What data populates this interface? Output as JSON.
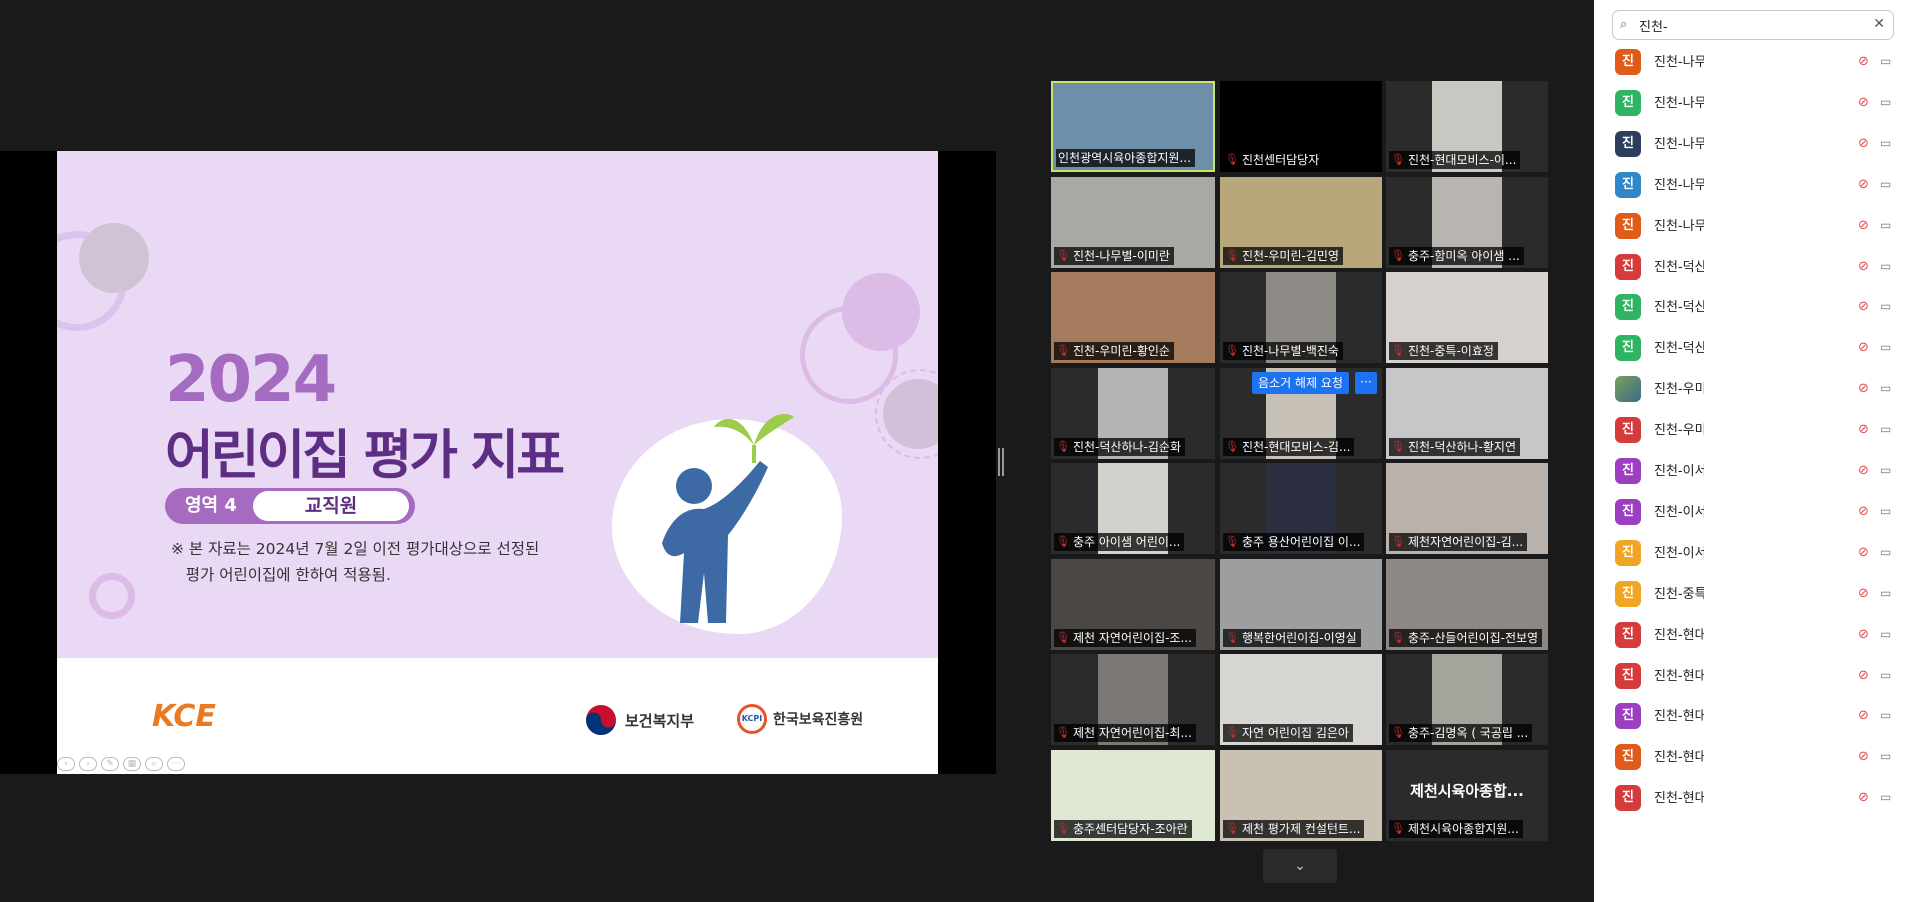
{
  "slide": {
    "year": "2024",
    "title": "어린이집 평가 지표",
    "area_label": "영역 4",
    "area_name": "교직원",
    "note": "※ 본 자료는 2024년 7월 2일 이전 평가대상으로 선정된\n   평가 어린이집에 한하여 적용됨.",
    "logo_kce": "KCE",
    "org1": "보건복지부",
    "org2": "한국보육진흥원",
    "org2_mark": "KCPI"
  },
  "gallery": {
    "unmute_request": "음소거 해제 요청",
    "more": "···",
    "tiles": [
      {
        "name": "인천광역시육아종합지원...",
        "bg": "#6f8ea8",
        "muted": false,
        "active": true
      },
      {
        "name": "진천센터담당자",
        "bg": "#000000",
        "muted": true
      },
      {
        "name": "진천-현대모비스-이...",
        "bg": "#c9c7c2",
        "muted": true
      },
      {
        "name": "진천-나무별-이미란",
        "bg": "#a9a9a4",
        "muted": true
      },
      {
        "name": "진천-우미린-김민영",
        "bg": "#b9a77c",
        "muted": true
      },
      {
        "name": "충주-함미옥 아이샘 ...",
        "bg": "#b8b5b0",
        "muted": true
      },
      {
        "name": "진천-우미린-황인순",
        "bg": "#a47c5d",
        "muted": true
      },
      {
        "name": "진천-나무별-백진숙",
        "bg": "#8e8a86",
        "muted": true
      },
      {
        "name": "진천-중특-이효정",
        "bg": "#d7d1cd",
        "muted": true
      },
      {
        "name": "진천-덕산하나-김순화",
        "bg": "#b3b4b5",
        "muted": true
      },
      {
        "name": "진천-현대모비스-김...",
        "bg": "#c7c0b6",
        "muted": true
      },
      {
        "name": "진천-덕산하나-황지연",
        "bg": "#c9c6c9",
        "muted": true
      },
      {
        "name": "충주 아이샘 어린이...",
        "bg": "#d2d1cc",
        "muted": true
      },
      {
        "name": "충주 용산어린이집 이...",
        "bg": "#2b2f3f",
        "muted": true
      },
      {
        "name": "제천자연어린이집-김...",
        "bg": "#b9b2ac",
        "muted": true
      },
      {
        "name": "제천 자연어린이집-조...",
        "bg": "#4b4744",
        "muted": true
      },
      {
        "name": "행복한어린이집-이영실",
        "bg": "#9c9e9f",
        "muted": true
      },
      {
        "name": "충주-산들어린이집-전보영",
        "bg": "#8d8785",
        "muted": true
      },
      {
        "name": "제천 자연어린이집-최...",
        "bg": "#7c7875",
        "muted": true
      },
      {
        "name": "자연 어린이집 김은아",
        "bg": "#d8d6d2",
        "muted": true
      },
      {
        "name": "충주-김명옥 ( 국공립 ...",
        "bg": "#a5a49c",
        "muted": true
      },
      {
        "name": "충주센터담당자-조아란",
        "bg": "#dfe8d2",
        "muted": true
      },
      {
        "name": "제천 평가제 컨설턴트...",
        "bg": "#c9c1b2",
        "muted": true
      },
      {
        "name": "제천시육아종합지원...",
        "bg": "#2b2b2b",
        "muted": true,
        "center": "제천시육아종합..."
      }
    ]
  },
  "panel": {
    "search_value": "진천-",
    "participants": [
      {
        "initial": "진",
        "name": "진천-나무",
        "color": "#e05a1a"
      },
      {
        "initial": "진",
        "name": "진천-나무",
        "color": "#2fb463"
      },
      {
        "initial": "진",
        "name": "진천-나무",
        "color": "#2c3e5c"
      },
      {
        "initial": "진",
        "name": "진천-나무",
        "color": "#2f86c8"
      },
      {
        "initial": "진",
        "name": "진천-나무",
        "color": "#e05a1a"
      },
      {
        "initial": "진",
        "name": "진천-덕산",
        "color": "#d63b3b"
      },
      {
        "initial": "진",
        "name": "진천-덕산",
        "color": "#2fb463"
      },
      {
        "initial": "진",
        "name": "진천-덕산",
        "color": "#2fb463"
      },
      {
        "initial": "",
        "name": "진천-우미",
        "color": "#5c8a4a"
      },
      {
        "initial": "진",
        "name": "진천-우미",
        "color": "#d63b3b"
      },
      {
        "initial": "진",
        "name": "진천-이서",
        "color": "#9c3fc0"
      },
      {
        "initial": "진",
        "name": "진천-이서",
        "color": "#9c3fc0"
      },
      {
        "initial": "진",
        "name": "진천-이서",
        "color": "#f0a524"
      },
      {
        "initial": "진",
        "name": "진천-중특",
        "color": "#f0a524"
      },
      {
        "initial": "진",
        "name": "진천-현대",
        "color": "#d63b3b"
      },
      {
        "initial": "진",
        "name": "진천-현대",
        "color": "#d63b3b"
      },
      {
        "initial": "진",
        "name": "진천-현대",
        "color": "#9c3fc0"
      },
      {
        "initial": "진",
        "name": "진천-현대",
        "color": "#e05a1a"
      },
      {
        "initial": "진",
        "name": "진천-현대",
        "color": "#d63b3b"
      }
    ]
  }
}
